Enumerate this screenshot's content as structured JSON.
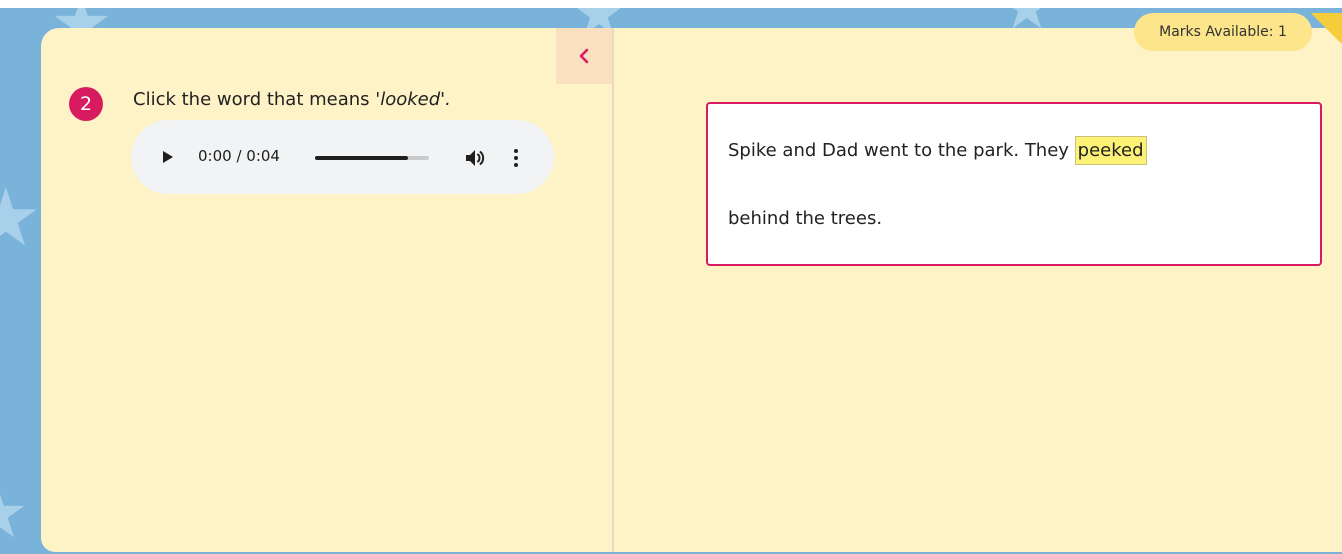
{
  "question": {
    "number": "2",
    "prompt_prefix": "Click the word that means ",
    "prompt_target": "'looked'.",
    "audio": {
      "time": "0:00 / 0:04",
      "progress": 0.82
    }
  },
  "marks": {
    "label": "Marks Available: 1"
  },
  "passage": {
    "line1_before": "Spike and Dad went to the park. They ",
    "highlighted_word": "peeked",
    "line2": "behind the trees."
  },
  "colors": {
    "accent": "#d81b60",
    "card_background": "#fef2c7",
    "sky": "#7ab3d9",
    "highlight": "#fdf276",
    "marks_badge": "#fce58a"
  },
  "icons": {
    "collapse": "chevron-left-icon",
    "play": "play-icon",
    "volume": "volume-icon",
    "more": "more-vertical-icon"
  }
}
